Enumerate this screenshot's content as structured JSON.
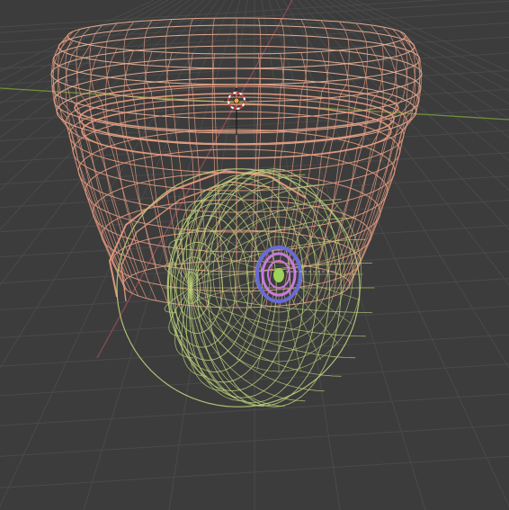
{
  "viewport": {
    "mode": "wireframe",
    "background_color": "#3c3c3c"
  },
  "colors": {
    "grid_line": "#4a4a4a",
    "x_axis": "#8a4a52",
    "y_axis": "#6f8f3a",
    "dome_housing_wire": "#e39a80",
    "dome_highlight_wire": "#f0b79a",
    "sphere_wire": "#bcd27a",
    "lens_outer": "#6a6ad8",
    "lens_inner": "#c87ae0",
    "lens_center": "#9ed05a",
    "cursor_red": "#d33b3b",
    "cursor_white": "#ffffff"
  },
  "icons": {
    "cursor": "3d-cursor-icon",
    "origin": "object-origin-icon"
  }
}
